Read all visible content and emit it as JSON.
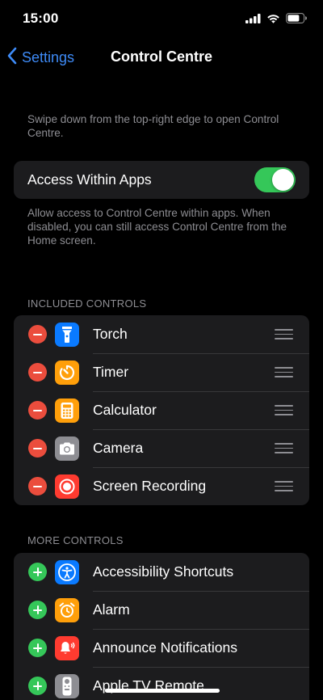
{
  "status_bar": {
    "time": "15:00"
  },
  "nav": {
    "back_label": "Settings",
    "title": "Control Centre"
  },
  "intro": {
    "text": "Swipe down from the top-right edge to open Control Centre."
  },
  "access": {
    "label": "Access Within Apps",
    "enabled": true,
    "footer": "Allow access to Control Centre within apps. When disabled, you can still access Control Centre from the Home screen."
  },
  "included": {
    "header": "INCLUDED CONTROLS",
    "items": [
      {
        "label": "Torch",
        "icon": "torch-icon",
        "color": "#0a7aff"
      },
      {
        "label": "Timer",
        "icon": "timer-icon",
        "color": "#ff9f0a"
      },
      {
        "label": "Calculator",
        "icon": "calculator-icon",
        "color": "#ff9f0a"
      },
      {
        "label": "Camera",
        "icon": "camera-icon",
        "color": "#8e8e93"
      },
      {
        "label": "Screen Recording",
        "icon": "screen-recording-icon",
        "color": "#ff3b30"
      }
    ]
  },
  "more": {
    "header": "MORE CONTROLS",
    "items": [
      {
        "label": "Accessibility Shortcuts",
        "icon": "accessibility-icon",
        "color": "#0a7aff"
      },
      {
        "label": "Alarm",
        "icon": "alarm-icon",
        "color": "#ff9f0a"
      },
      {
        "label": "Announce Notifications",
        "icon": "announce-notifications-icon",
        "color": "#ff3b30"
      },
      {
        "label": "Apple TV Remote",
        "icon": "apple-tv-remote-icon",
        "color": "#8e8e93"
      }
    ]
  },
  "colors": {
    "accent": "#3e8bf7",
    "remove": "#eb4d3d",
    "add": "#35c759",
    "cell": "#1c1c1e",
    "secondary_text": "#8d8d92"
  }
}
